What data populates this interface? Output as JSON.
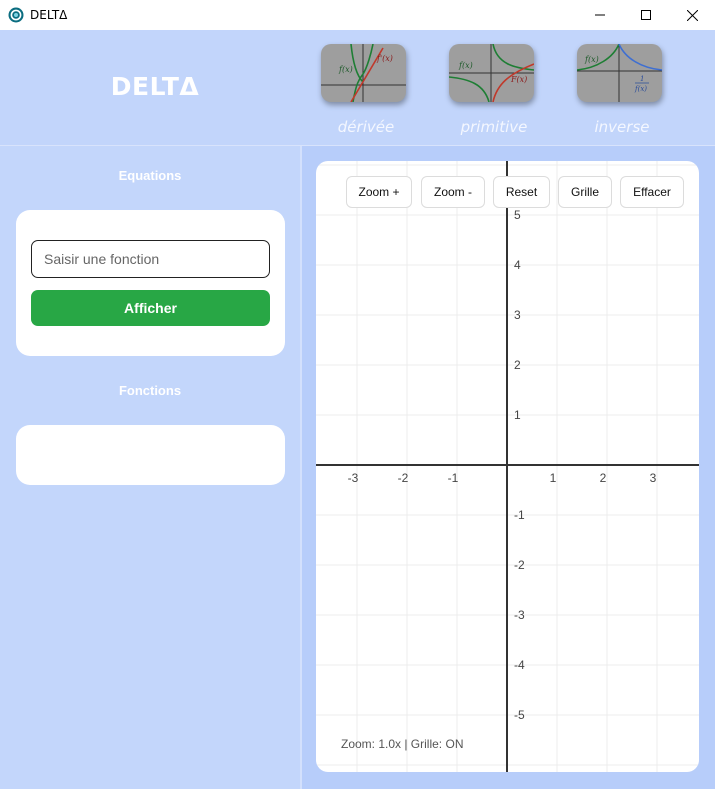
{
  "window": {
    "title": "DELTΔ"
  },
  "header": {
    "brand": "DELTΔ",
    "tools": [
      {
        "id": "derivee",
        "label": "dérivée",
        "fx": "f(x)",
        "fpx": "f'(x)"
      },
      {
        "id": "primitive",
        "label": "primitive",
        "fx": "f(x)",
        "Fx": "F(x)"
      },
      {
        "id": "inverse",
        "label": "inverse",
        "fx": "f(x)",
        "one": "1",
        "den": "f(x)"
      }
    ]
  },
  "sidebar": {
    "equations_title": "Equations",
    "input_placeholder": "Saisir une fonction",
    "input_value": "",
    "show_button": "Afficher",
    "functions_title": "Fonctions"
  },
  "graph": {
    "buttons": {
      "zoom_in": "Zoom +",
      "zoom_out": "Zoom -",
      "reset": "Reset",
      "grid": "Grille",
      "clear": "Effacer"
    },
    "x_ticks": [
      "-3",
      "-2",
      "-1",
      "1",
      "2",
      "3"
    ],
    "y_ticks": [
      "5",
      "4",
      "3",
      "2",
      "1",
      "-1",
      "-2",
      "-3",
      "-4",
      "-5"
    ],
    "status": "Zoom: 1.0x | Grille: ON",
    "zoom": 1.0,
    "grid_on": true
  },
  "colors": {
    "accent_green": "#28a745",
    "background": "#c4d6fb",
    "derivative_red": "#c0392b",
    "function_green": "#1e7e34",
    "inverse_blue": "#3f6fd1"
  }
}
